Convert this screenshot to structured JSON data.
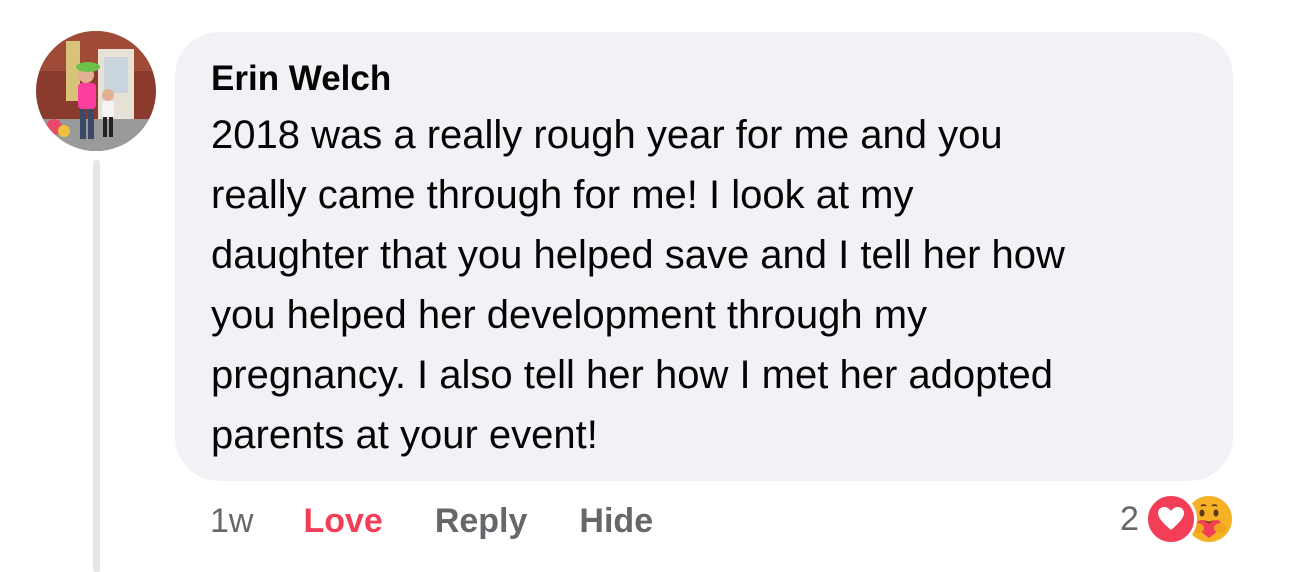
{
  "comment": {
    "author": "Erin Welch",
    "text": "2018 was a really rough year for me and you\nreally came through for me! I look at my\ndaughter that you helped save and I tell her how\nyou helped her development through my\npregnancy. I also tell her how I met her adopted\nparents at your event!",
    "avatar_icon": "profile-photo"
  },
  "actions": {
    "time": "1w",
    "love_label": "Love",
    "reply_label": "Reply",
    "hide_label": "Hide"
  },
  "reactions": {
    "count": "2",
    "types": [
      "love",
      "care"
    ]
  },
  "colors": {
    "bubble": "#f0f2f5",
    "love": "#f33e58",
    "muted": "#65676b",
    "text": "#050505",
    "care": "#f7b125"
  }
}
